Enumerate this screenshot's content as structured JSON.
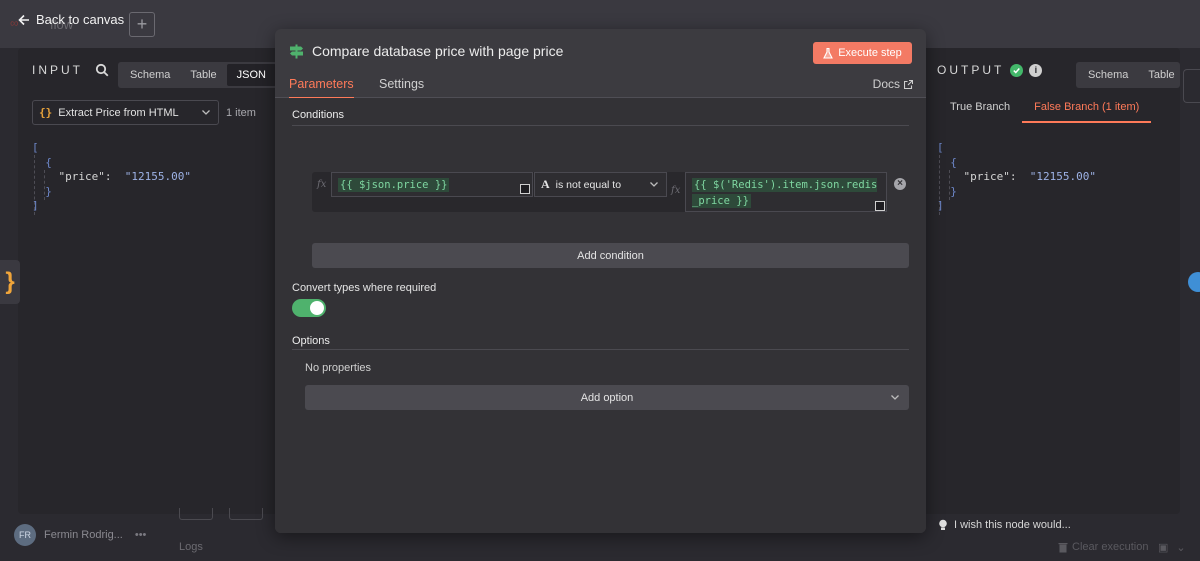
{
  "app": {
    "back_label": "Back to canvas",
    "workflow_name_partial": "flow",
    "user_name": "Fermin Rodrig...",
    "user_initials": "FR",
    "logs_label": "Logs",
    "clear_execution_label": "Clear execution"
  },
  "input_panel": {
    "title": "INPUT",
    "view_tabs": [
      "Schema",
      "Table",
      "JSON"
    ],
    "active_view": "JSON",
    "node_selector": "Extract Price from HTML",
    "item_count": "1 item",
    "json": {
      "key": "\"price\":",
      "value": "\"12155.00\""
    }
  },
  "output_panel": {
    "title": "OUTPUT",
    "view_tabs": [
      "Schema",
      "Table"
    ],
    "branch_tabs": [
      "True Branch",
      "False Branch (1 item)"
    ],
    "active_branch": "False Branch (1 item)",
    "json": {
      "key": "\"price\":",
      "value": "\"12155.00\""
    },
    "feedback": "I wish this node would..."
  },
  "modal": {
    "title": "Compare database price with page price",
    "execute_label": "Execute step",
    "tabs": [
      "Parameters",
      "Settings"
    ],
    "active_tab": "Parameters",
    "docs_label": "Docs",
    "conditions_title": "Conditions",
    "condition": {
      "left_value": "{{ $json.price }}",
      "operator": "is not equal to",
      "right_value": "{{ $('Redis').item.json.redis_price }}"
    },
    "add_condition_label": "Add condition",
    "convert_types_label": "Convert types where required",
    "convert_types_enabled": true,
    "options_title": "Options",
    "no_properties": "No properties",
    "add_option_label": "Add option"
  },
  "colors": {
    "accent": "#ff7a59",
    "execute_button": "#f37a64",
    "toggle_on": "#4fb26d",
    "success": "#43b86a",
    "expression_text": "#7fd7a1"
  }
}
